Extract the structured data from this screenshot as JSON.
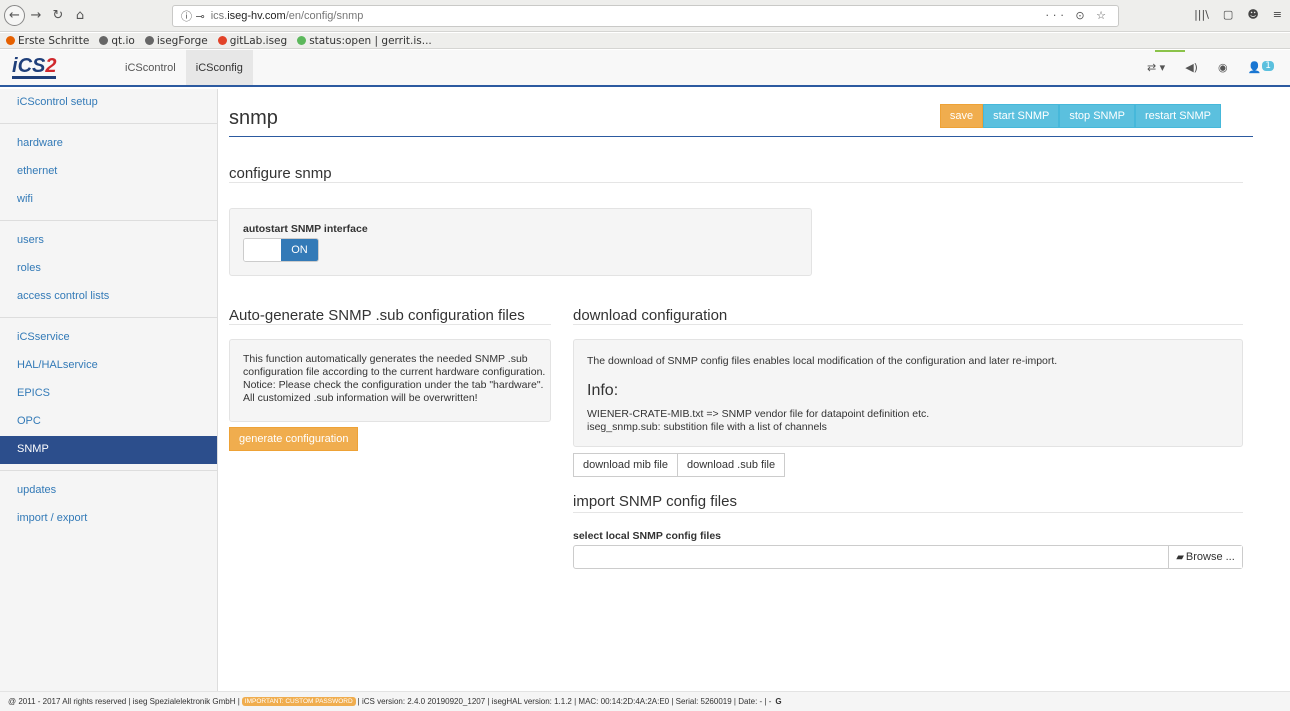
{
  "browser": {
    "url_prefix": "ics.",
    "url_host": "iseg-hv.com",
    "url_path": "/en/config/snmp",
    "url_right_icons": "··· ⊙ ☆",
    "right_icons": [
      "|||\\",
      "▢",
      "☻",
      "≡"
    ]
  },
  "bookmarks": [
    {
      "label": "Erste Schritte",
      "color": "#e66000"
    },
    {
      "label": "qt.io",
      "color": "#666666"
    },
    {
      "label": "isegForge",
      "color": "#666666"
    },
    {
      "label": "gitLab.iseg",
      "color": "#e24329"
    },
    {
      "label": "status:open | gerrit.is...",
      "color": "#5cb85c"
    }
  ],
  "app": {
    "logo_i": "i",
    "logo_cs": "CS",
    "logo_2": "2",
    "tabs": [
      {
        "label": "iCScontrol",
        "active": false
      },
      {
        "label": "iCSconfig",
        "active": true
      }
    ],
    "right_icons": [
      "⇄ ▾",
      "◀)",
      "◉"
    ],
    "user_badge": "1"
  },
  "sidebar": {
    "groups": [
      [
        "iCScontrol setup"
      ],
      [
        "hardware",
        "ethernet",
        "wifi"
      ],
      [
        "users",
        "roles",
        "access control lists"
      ],
      [
        "iCSservice",
        "HAL/HALservice",
        "EPICS",
        "OPC",
        "SNMP"
      ],
      [
        "updates",
        "import / export"
      ]
    ],
    "active": "SNMP"
  },
  "page": {
    "title": "snmp",
    "buttons": {
      "save": "save",
      "start": "start SNMP",
      "stop": "stop SNMP",
      "restart": "restart SNMP"
    }
  },
  "configure": {
    "heading": "configure snmp",
    "autostart_label": "autostart SNMP interface",
    "switch_state": "ON"
  },
  "autogen": {
    "heading": "Auto-generate SNMP .sub configuration files",
    "lines": [
      "This function automatically generates the needed SNMP .sub",
      "configuration file according to the current hardware configuration.",
      "Notice: Please check the configuration under the tab \"hardware\".",
      "All customized .sub information will be overwritten!"
    ],
    "button": "generate configuration"
  },
  "download": {
    "heading": "download configuration",
    "intro": "The download of SNMP config files enables local modification of the configuration and later re-import.",
    "info_heading": "Info:",
    "info_lines": [
      "WIENER-CRATE-MIB.txt => SNMP vendor file for datapoint definition etc.",
      "iseg_snmp.sub: substition file with a list of channels"
    ],
    "mib_button": "download mib file",
    "sub_button": "download .sub file"
  },
  "import": {
    "heading": "import SNMP config files",
    "label": "select local SNMP config files",
    "browse": "Browse ..."
  },
  "footer": {
    "left": "@ 2011 - 2017 All rights reserved | iseg Spezialelektronik GmbH |",
    "badge": "IMPORTANT: CUSTOM PASSWORD",
    "right": "| iCS version: 2.4.0 20190920_1207 | isegHAL version: 1.1.2 | MAC: 00:14:2D:4A:2A:E0 | Serial: 5260019 | Date: - | -",
    "icon": "G"
  }
}
